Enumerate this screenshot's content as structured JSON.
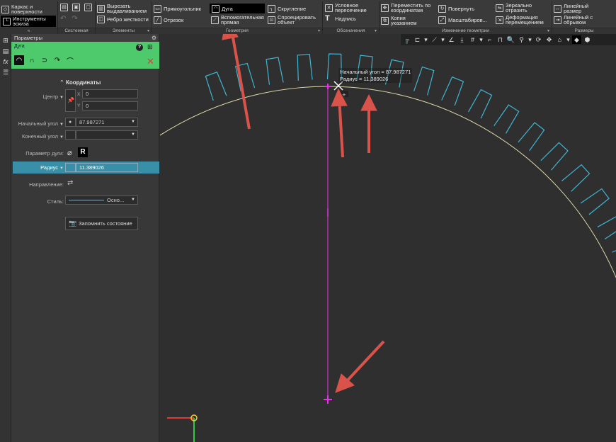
{
  "ribbon": {
    "col1": {
      "item1": "Каркас и поверхности",
      "item2": "Инструменты эскиза"
    },
    "col3": {
      "item1": "Вырезать выдавливанием",
      "item2": "Ребро жесткости"
    },
    "col4": {
      "item1": "Прямоугольник",
      "item2": "Отрезок"
    },
    "col5": {
      "item1": "Дуга",
      "item2": "Вспомогательная прямая"
    },
    "col6": {
      "item1": "Скругление",
      "item2": "Спроецировать объект"
    },
    "col7": {
      "item1": "Условное пересечение",
      "item2": "Надпись"
    },
    "col8": {
      "item1": "Переместить по координатам",
      "item2": "Копия указанием"
    },
    "col9": {
      "item1": "Повернуть",
      "item2": "Масштабиров..."
    },
    "col10": {
      "item1": "Зеркально отразить",
      "item2": "Деформация перемещением"
    },
    "col11": {
      "item1": "Линейный размер",
      "item2": "Линейный с обрывом"
    },
    "groups": {
      "g1": "«",
      "g2": "Системная",
      "g3": "Элементы",
      "g4": "Геометрия",
      "g5": "Обозначения",
      "g6": "Изменение геометрии",
      "g7": "Размеры"
    }
  },
  "panel": {
    "title": "Параметры",
    "mode_name": "Дуга",
    "coords_header": "Координаты",
    "center_label": "Центр",
    "center_x_axis": "X",
    "center_y_axis": "Y",
    "center_x": "0",
    "center_y": "0",
    "start_angle_label": "Начальный угол",
    "start_angle": "87.987271",
    "end_angle_label": "Конечный угол",
    "end_angle": "",
    "arc_param_label": "Параметр дуги:",
    "arc_param_r": "R",
    "radius_label": "Радиус",
    "radius": "11.389026",
    "direction_label": "Направление:",
    "style_label": "Стиль:",
    "style_value": "Осно...",
    "save_state": "Запомнить состояние"
  },
  "canvas": {
    "tooltip_line1": "Начальный угол = 87.987271",
    "tooltip_line2": "Радиус = 11.389026"
  },
  "colors": {
    "accent_green": "#4ec96c",
    "radius_row": "#3a8fa8",
    "teeth": "#3fb6d2",
    "arc": "#dcd7a8",
    "magenta": "#e830e8",
    "arrow": "#d9534a"
  }
}
